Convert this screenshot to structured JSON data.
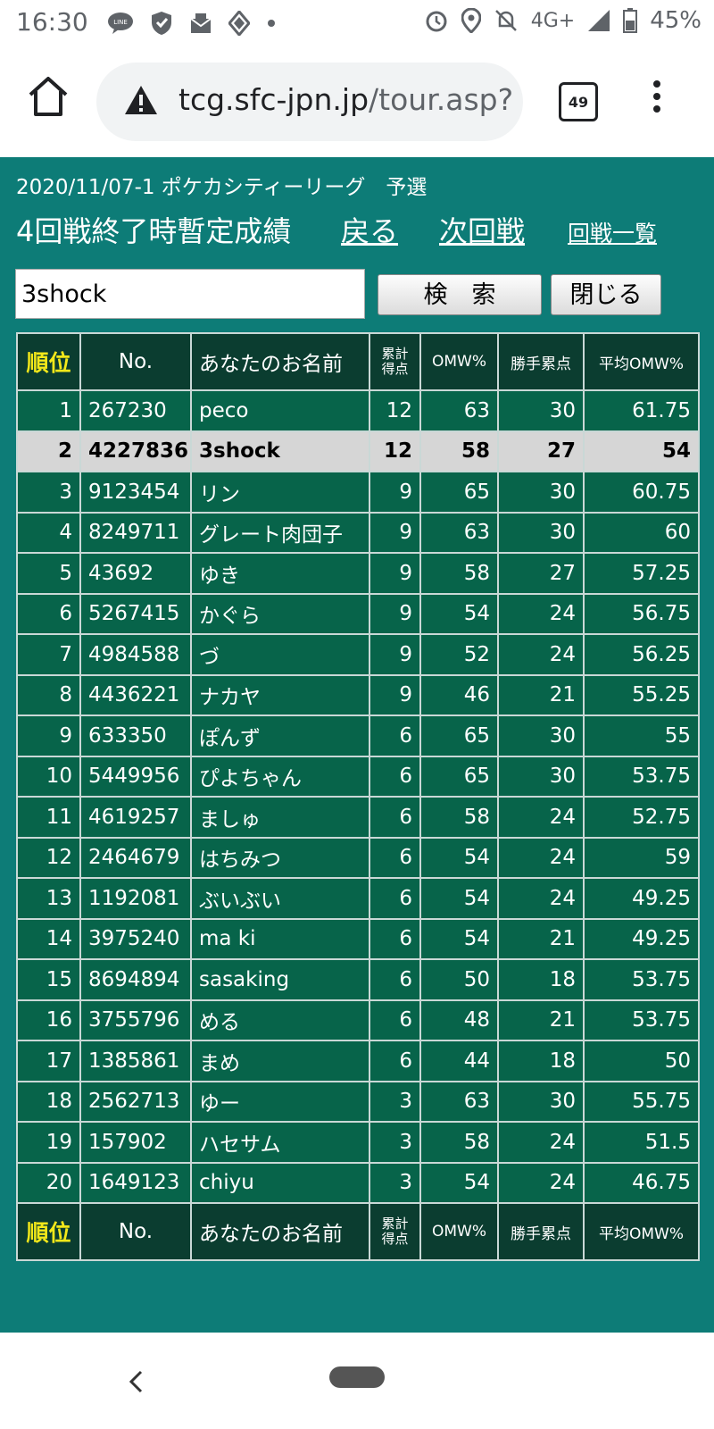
{
  "status_bar": {
    "time": "16:30",
    "network": "4G+",
    "battery": "45%"
  },
  "browser": {
    "url_main": "tcg.sfc-jpn.jp",
    "url_path": "/tour.asp?",
    "tab_count": "49"
  },
  "page": {
    "crumb": "2020/11/07-1 ポケカシティーリーグ　予選",
    "heading": "4回戦終了時暫定成績",
    "back_link": "戻る",
    "next_link": "次回戦",
    "list_link": "回戦一覧",
    "search_value": "3shock",
    "search_button": "検　索",
    "close_button": "閉じる"
  },
  "table": {
    "headers": {
      "rank": "順位",
      "no": "No.",
      "name": "あなたのお名前",
      "points_1": "累計",
      "points_2": "得点",
      "omw": "OMW%",
      "win_points": "勝手累点",
      "avg_omw": "平均OMW%"
    },
    "rows": [
      {
        "rank": "1",
        "no": "267230",
        "name": "peco",
        "points": "12",
        "omw": "63",
        "win": "30",
        "avg": "61.75"
      },
      {
        "rank": "2",
        "no": "4227836",
        "name": "3shock",
        "points": "12",
        "omw": "58",
        "win": "27",
        "avg": "54"
      },
      {
        "rank": "3",
        "no": "9123454",
        "name": "リン",
        "points": "9",
        "omw": "65",
        "win": "30",
        "avg": "60.75"
      },
      {
        "rank": "4",
        "no": "8249711",
        "name": "グレート肉団子",
        "points": "9",
        "omw": "63",
        "win": "30",
        "avg": "60"
      },
      {
        "rank": "5",
        "no": "43692",
        "name": "ゆき",
        "points": "9",
        "omw": "58",
        "win": "27",
        "avg": "57.25"
      },
      {
        "rank": "6",
        "no": "5267415",
        "name": "かぐら",
        "points": "9",
        "omw": "54",
        "win": "24",
        "avg": "56.75"
      },
      {
        "rank": "7",
        "no": "4984588",
        "name": "づ",
        "points": "9",
        "omw": "52",
        "win": "24",
        "avg": "56.25"
      },
      {
        "rank": "8",
        "no": "4436221",
        "name": "ナカヤ",
        "points": "9",
        "omw": "46",
        "win": "21",
        "avg": "55.25"
      },
      {
        "rank": "9",
        "no": "633350",
        "name": "ぽんず",
        "points": "6",
        "omw": "65",
        "win": "30",
        "avg": "55"
      },
      {
        "rank": "10",
        "no": "5449956",
        "name": "ぴよちゃん",
        "points": "6",
        "omw": "65",
        "win": "30",
        "avg": "53.75"
      },
      {
        "rank": "11",
        "no": "4619257",
        "name": "ましゅ",
        "points": "6",
        "omw": "58",
        "win": "24",
        "avg": "52.75"
      },
      {
        "rank": "12",
        "no": "2464679",
        "name": "はちみつ",
        "points": "6",
        "omw": "54",
        "win": "24",
        "avg": "59"
      },
      {
        "rank": "13",
        "no": "1192081",
        "name": "ぶいぶい",
        "points": "6",
        "omw": "54",
        "win": "24",
        "avg": "49.25"
      },
      {
        "rank": "14",
        "no": "3975240",
        "name": "ma ki",
        "points": "6",
        "omw": "54",
        "win": "21",
        "avg": "49.25"
      },
      {
        "rank": "15",
        "no": "8694894",
        "name": "sasaking",
        "points": "6",
        "omw": "50",
        "win": "18",
        "avg": "53.75"
      },
      {
        "rank": "16",
        "no": "3755796",
        "name": "める",
        "points": "6",
        "omw": "48",
        "win": "21",
        "avg": "53.75"
      },
      {
        "rank": "17",
        "no": "1385861",
        "name": "まめ",
        "points": "6",
        "omw": "44",
        "win": "18",
        "avg": "50"
      },
      {
        "rank": "18",
        "no": "2562713",
        "name": "ゆー",
        "points": "3",
        "omw": "63",
        "win": "30",
        "avg": "55.75"
      },
      {
        "rank": "19",
        "no": "157902",
        "name": "ハセサム",
        "points": "3",
        "omw": "58",
        "win": "24",
        "avg": "51.5"
      },
      {
        "rank": "20",
        "no": "1649123",
        "name": "chiyu",
        "points": "3",
        "omw": "54",
        "win": "24",
        "avg": "46.75"
      }
    ],
    "highlight_rank": "2"
  },
  "colors": {
    "page_bg": "#0d7c77",
    "row_bg": "#07644a",
    "header_bg": "#0b3d30",
    "rank_header": "#f3e81a",
    "highlight_row": "#d6d6d6"
  }
}
